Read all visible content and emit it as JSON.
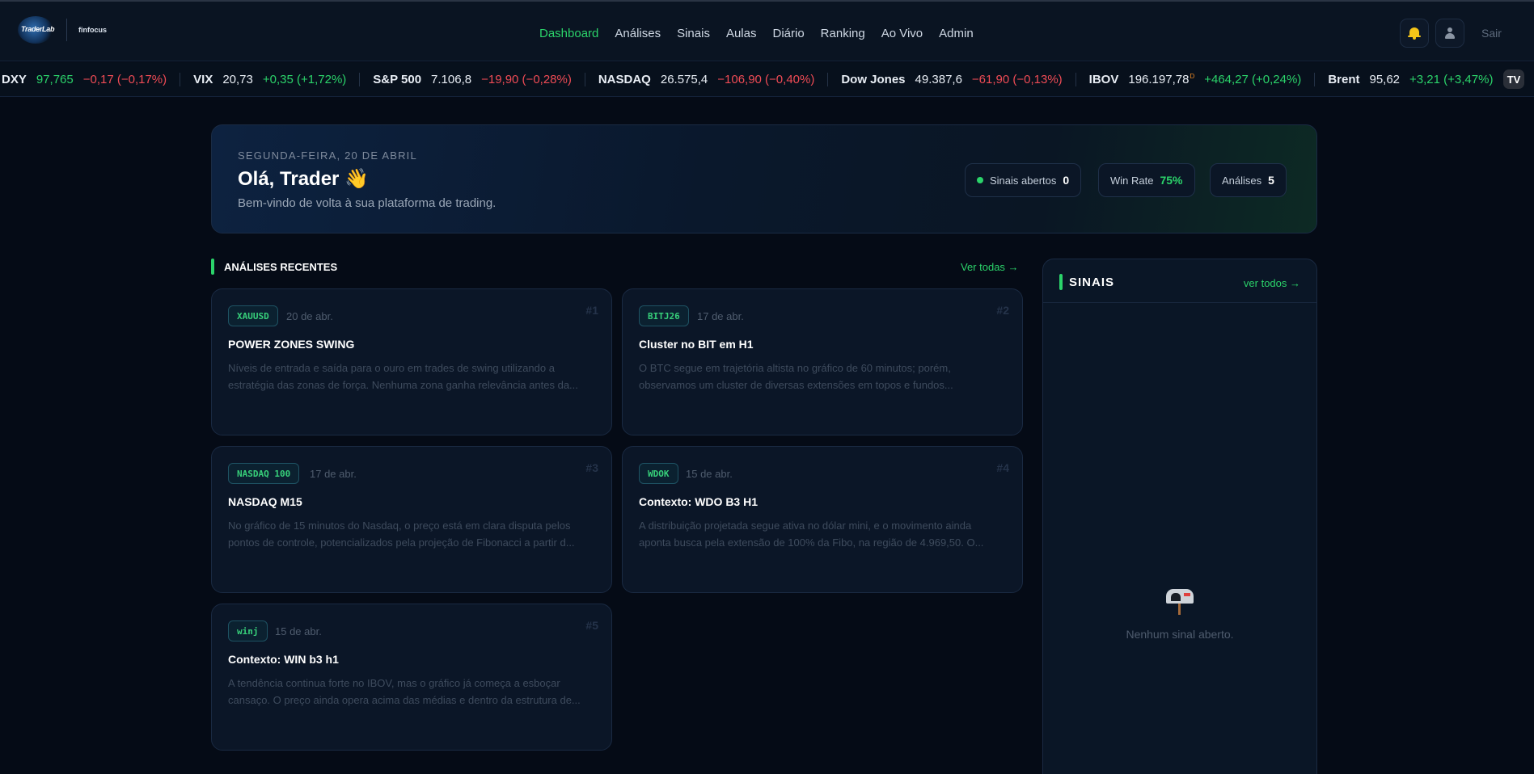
{
  "header": {
    "logo_text": "TraderLab",
    "partner": "finfocus",
    "nav": [
      "Dashboard",
      "Análises",
      "Sinais",
      "Aulas",
      "Diário",
      "Ranking",
      "Ao Vivo",
      "Admin"
    ],
    "active_nav": "Dashboard",
    "logout_label": "Sair",
    "icons": [
      "bell-icon",
      "user-icon"
    ]
  },
  "ticker": {
    "items": [
      {
        "symbol": "DXY",
        "value": "97,765",
        "change": "−0,17 (−0,17%)",
        "direction": "down"
      },
      {
        "symbol": "VIX",
        "value": "20,73",
        "change": "+0,35 (+1,72%)",
        "direction": "up"
      },
      {
        "symbol": "S&P 500",
        "value": "7.106,8",
        "change": "−19,90 (−0,28%)",
        "direction": "down"
      },
      {
        "symbol": "NASDAQ",
        "value": "26.575,4",
        "change": "−106,90 (−0,40%)",
        "direction": "down"
      },
      {
        "symbol": "Dow Jones",
        "value": "49.387,6",
        "change": "−61,90 (−0,13%)",
        "direction": "down"
      },
      {
        "symbol": "IBOV",
        "value": "196.197,78",
        "value_marker": "D",
        "change": "+464,27 (+0,24%)",
        "direction": "up"
      },
      {
        "symbol": "Brent",
        "value": "95,62",
        "change": "+3,21 (+3,47%)",
        "direction": "up"
      }
    ],
    "badge": "TV"
  },
  "hero": {
    "date": "SEGUNDA-FEIRA, 20 DE ABRIL",
    "greeting": "Olá, Trader 👋",
    "subtitle": "Bem-vindo de volta à sua plataforma de trading.",
    "stats": {
      "open_signals_label": "Sinais abertos",
      "open_signals_value": "0",
      "win_rate_label": "Win Rate",
      "win_rate_value": "75%",
      "analyses_label": "Análises",
      "analyses_value": "5"
    }
  },
  "analyses": {
    "section_title": "ANÁLISES RECENTES",
    "see_all": "Ver todas →",
    "cards": [
      {
        "tag": "XAUUSD",
        "date": "20 de abr.",
        "num": "#1",
        "title": "POWER ZONES SWING",
        "desc": "Níveis de entrada e saída para o ouro em trades de swing utilizando a estratégia das zonas de força. Nenhuma zona ganha relevância antes da..."
      },
      {
        "tag": "BITJ26",
        "date": "17 de abr.",
        "num": "#2",
        "title": "Cluster no BIT em H1",
        "desc": "O BTC segue em trajetória altista no gráfico de 60 minutos; porém, observamos um cluster de diversas extensões em topos e fundos..."
      },
      {
        "tag": "NASDAQ 100",
        "date": "17 de abr.",
        "num": "#3",
        "title": "NASDAQ M15",
        "desc": "No gráfico de 15 minutos do Nasdaq, o preço está em clara disputa pelos pontos de controle, potencializados pela projeção de Fibonacci a partir d..."
      },
      {
        "tag": "WDOK",
        "date": "15 de abr.",
        "num": "#4",
        "title": "Contexto: WDO B3 H1",
        "desc": "A distribuição projetada segue ativa no dólar mini, e o movimento ainda aponta busca pela extensão de 100% da Fibo, na região de 4.969,50. O..."
      },
      {
        "tag": "winj",
        "date": "15 de abr.",
        "num": "#5",
        "title": "Contexto: WIN b3 h1",
        "desc": "A tendência continua forte no IBOV, mas o gráfico já começa a esboçar cansaço. O preço ainda opera acima das médias e dentro da estrutura de..."
      }
    ]
  },
  "signals": {
    "title": "SINAIS",
    "see_all": "ver todos →",
    "empty_text": "Nenhum sinal aberto.",
    "empty_icon": "mailbox-icon"
  },
  "colors": {
    "accent": "#2bd36a",
    "negative": "#ef4b55",
    "background": "#050b16"
  }
}
